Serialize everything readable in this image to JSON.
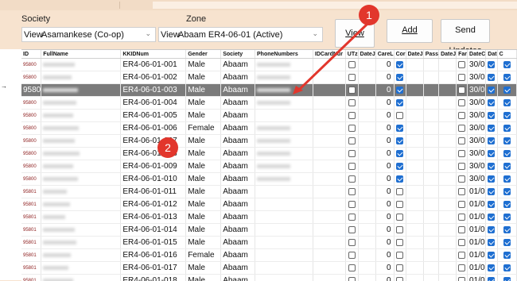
{
  "filters": {
    "society_label": "Society",
    "zone_label": "Zone",
    "society_prefix": "View",
    "society_value": "Asamankese (Co-op)",
    "zone_prefix": "View",
    "zone_value": "Abaam ER4-06-01 (Active)"
  },
  "buttons": {
    "view": "View",
    "add": "Add",
    "send_updates": "Send Updates"
  },
  "annotations": {
    "badge1": "1",
    "badge2": "2"
  },
  "colors": {
    "badge": "#e2362c",
    "selected_row": "#7b7b7b",
    "checkbox_on": "#1f6fd1",
    "background": "#f7e3cf"
  },
  "grid": {
    "headers": [
      "ID",
      "FullName",
      "KKIDNum",
      "Gender",
      "Society",
      "PhoneNumbers",
      "IDCardNur",
      "UTz",
      "DateJ",
      "CareL",
      "Cor",
      "DateJ",
      "Pass",
      "DateJ",
      "Far",
      "DateC",
      "Dat",
      "C"
    ],
    "rows": [
      {
        "id": "95800",
        "kk": "ER4-06-01-001",
        "gender": "Male",
        "society": "Abaam",
        "phone": true,
        "careL": "0",
        "cor": true,
        "far": false,
        "dateC": "30/0",
        "dat": true,
        "c": true
      },
      {
        "id": "95800",
        "kk": "ER4-06-01-002",
        "gender": "Male",
        "society": "Abaam",
        "phone": true,
        "careL": "0",
        "cor": true,
        "far": false,
        "dateC": "30/0",
        "dat": true,
        "c": true
      },
      {
        "id": "9580",
        "kk": "ER4-06-01-003",
        "gender": "Male",
        "society": "Abaam",
        "phone": true,
        "careL": "0",
        "cor": true,
        "far": false,
        "dateC": "30/0",
        "dat": true,
        "c": true,
        "selected": true
      },
      {
        "id": "95800",
        "kk": "ER4-06-01-004",
        "gender": "Male",
        "society": "Abaam",
        "phone": true,
        "careL": "0",
        "cor": true,
        "far": false,
        "dateC": "30/0",
        "dat": true,
        "c": true
      },
      {
        "id": "95800",
        "kk": "ER4-06-01-005",
        "gender": "Male",
        "society": "Abaam",
        "phone": false,
        "careL": "0",
        "cor": false,
        "far": false,
        "dateC": "30/0",
        "dat": true,
        "c": true
      },
      {
        "id": "95800",
        "kk": "ER4-06-01-006",
        "gender": "Female",
        "society": "Abaam",
        "phone": true,
        "careL": "0",
        "cor": true,
        "far": false,
        "dateC": "30/0",
        "dat": true,
        "c": true
      },
      {
        "id": "95800",
        "kk": "ER4-06-01-007",
        "gender": "Male",
        "society": "Abaam",
        "phone": true,
        "careL": "0",
        "cor": true,
        "far": false,
        "dateC": "30/0",
        "dat": true,
        "c": true
      },
      {
        "id": "95800",
        "kk": "ER4-06-01-008",
        "gender": "Male",
        "society": "Abaam",
        "phone": true,
        "careL": "0",
        "cor": true,
        "far": false,
        "dateC": "30/0",
        "dat": true,
        "c": true
      },
      {
        "id": "95800",
        "kk": "ER4-06-01-009",
        "gender": "Male",
        "society": "Abaam",
        "phone": true,
        "careL": "0",
        "cor": true,
        "far": false,
        "dateC": "30/0",
        "dat": true,
        "c": true
      },
      {
        "id": "95800",
        "kk": "ER4-06-01-010",
        "gender": "Male",
        "society": "Abaam",
        "phone": true,
        "careL": "0",
        "cor": true,
        "far": false,
        "dateC": "30/0",
        "dat": true,
        "c": true
      },
      {
        "id": "95801",
        "kk": "ER4-06-01-011",
        "gender": "Male",
        "society": "Abaam",
        "phone": false,
        "careL": "0",
        "cor": false,
        "far": false,
        "dateC": "01/0",
        "dat": true,
        "c": true
      },
      {
        "id": "95801",
        "kk": "ER4-06-01-012",
        "gender": "Male",
        "society": "Abaam",
        "phone": false,
        "careL": "0",
        "cor": false,
        "far": false,
        "dateC": "01/0",
        "dat": true,
        "c": true
      },
      {
        "id": "95801",
        "kk": "ER4-06-01-013",
        "gender": "Male",
        "society": "Abaam",
        "phone": false,
        "careL": "0",
        "cor": false,
        "far": false,
        "dateC": "01/0",
        "dat": true,
        "c": true
      },
      {
        "id": "95801",
        "kk": "ER4-06-01-014",
        "gender": "Male",
        "society": "Abaam",
        "phone": false,
        "careL": "0",
        "cor": false,
        "far": false,
        "dateC": "01/0",
        "dat": true,
        "c": true
      },
      {
        "id": "95801",
        "kk": "ER4-06-01-015",
        "gender": "Male",
        "society": "Abaam",
        "phone": false,
        "careL": "0",
        "cor": false,
        "far": false,
        "dateC": "01/0",
        "dat": true,
        "c": true
      },
      {
        "id": "95801",
        "kk": "ER4-06-01-016",
        "gender": "Female",
        "society": "Abaam",
        "phone": false,
        "careL": "0",
        "cor": false,
        "far": false,
        "dateC": "01/0",
        "dat": true,
        "c": true
      },
      {
        "id": "95801",
        "kk": "ER4-06-01-017",
        "gender": "Male",
        "society": "Abaam",
        "phone": false,
        "careL": "0",
        "cor": false,
        "far": false,
        "dateC": "01/0",
        "dat": true,
        "c": true
      },
      {
        "id": "95801",
        "kk": "ER4-06-01-018",
        "gender": "Male",
        "society": "Abaam",
        "phone": false,
        "careL": "0",
        "cor": false,
        "far": false,
        "dateC": "01/0",
        "dat": true,
        "c": true
      }
    ]
  }
}
